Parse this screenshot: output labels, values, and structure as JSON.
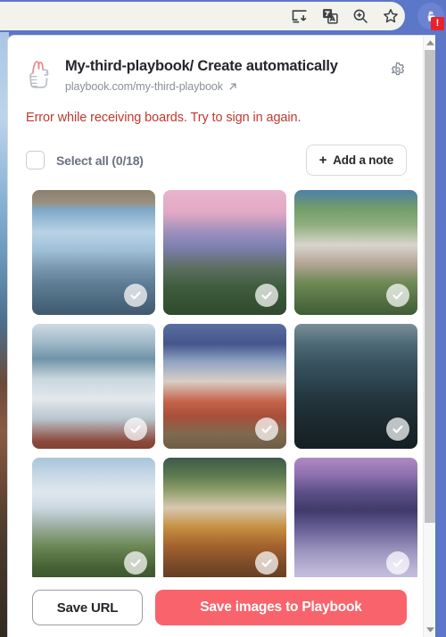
{
  "browser": {
    "toolbar_icons": [
      {
        "name": "install-app-icon",
        "label": "Install page as app"
      },
      {
        "name": "translate-icon",
        "label": "Translate this page"
      },
      {
        "name": "zoom-icon",
        "label": "Zoom"
      },
      {
        "name": "bookmark-star-icon",
        "label": "Bookmark this tab"
      }
    ],
    "extension_action": {
      "name": "playbook-extension-icon",
      "badge_text": "!",
      "badge_color": "#e8222b",
      "highlight_color": "#6b83d0",
      "toolbar_color": "#5c76c8"
    }
  },
  "popup": {
    "logo_name": "playbook-thumbs-up-logo",
    "title": "My-third-playbook/ Create automatically",
    "url": "playbook.com/my-third-playbook",
    "external_link_icon": "external-link-arrow-icon",
    "settings_icon": "gear-icon",
    "error_message": "Error while receiving boards. Try to sign in again.",
    "error_color": "#c0392e",
    "select_all": {
      "label": "Select all (0/18)",
      "checked": false,
      "selected_count": 0,
      "total_count": 18
    },
    "add_note_button": {
      "plus": "+",
      "label": "Add a note"
    },
    "thumbnails": [
      {
        "alt": "Stone archway framing a misty lake and mountain valley",
        "selected": false
      },
      {
        "alt": "Neuschwanstein castle under a pink sunset sky",
        "selected": false
      },
      {
        "alt": "White castle surrounded by dense green forest",
        "selected": false
      },
      {
        "alt": "Snow-covered castle in a winter landscape",
        "selected": false
      },
      {
        "alt": "Castle in autumn with blue mountain backdrop",
        "selected": false
      },
      {
        "alt": "Dark moody castle above a foggy valley",
        "selected": false
      },
      {
        "alt": "Castle under a bright cloudy sky with a lake",
        "selected": false
      },
      {
        "alt": "Castle on a ridge among golden autumn trees",
        "selected": false
      },
      {
        "alt": "Purple twilight castle above frosted treetops",
        "selected": false
      }
    ],
    "actions": {
      "save_url_label": "Save URL",
      "save_images_label": "Save images to Playbook",
      "save_images_color": "#f9636b"
    },
    "scrollbar": {
      "name": "popup-scrollbar",
      "up_arrow": "scroll-up-arrow-icon",
      "down_arrow": "scroll-down-arrow-icon"
    }
  }
}
